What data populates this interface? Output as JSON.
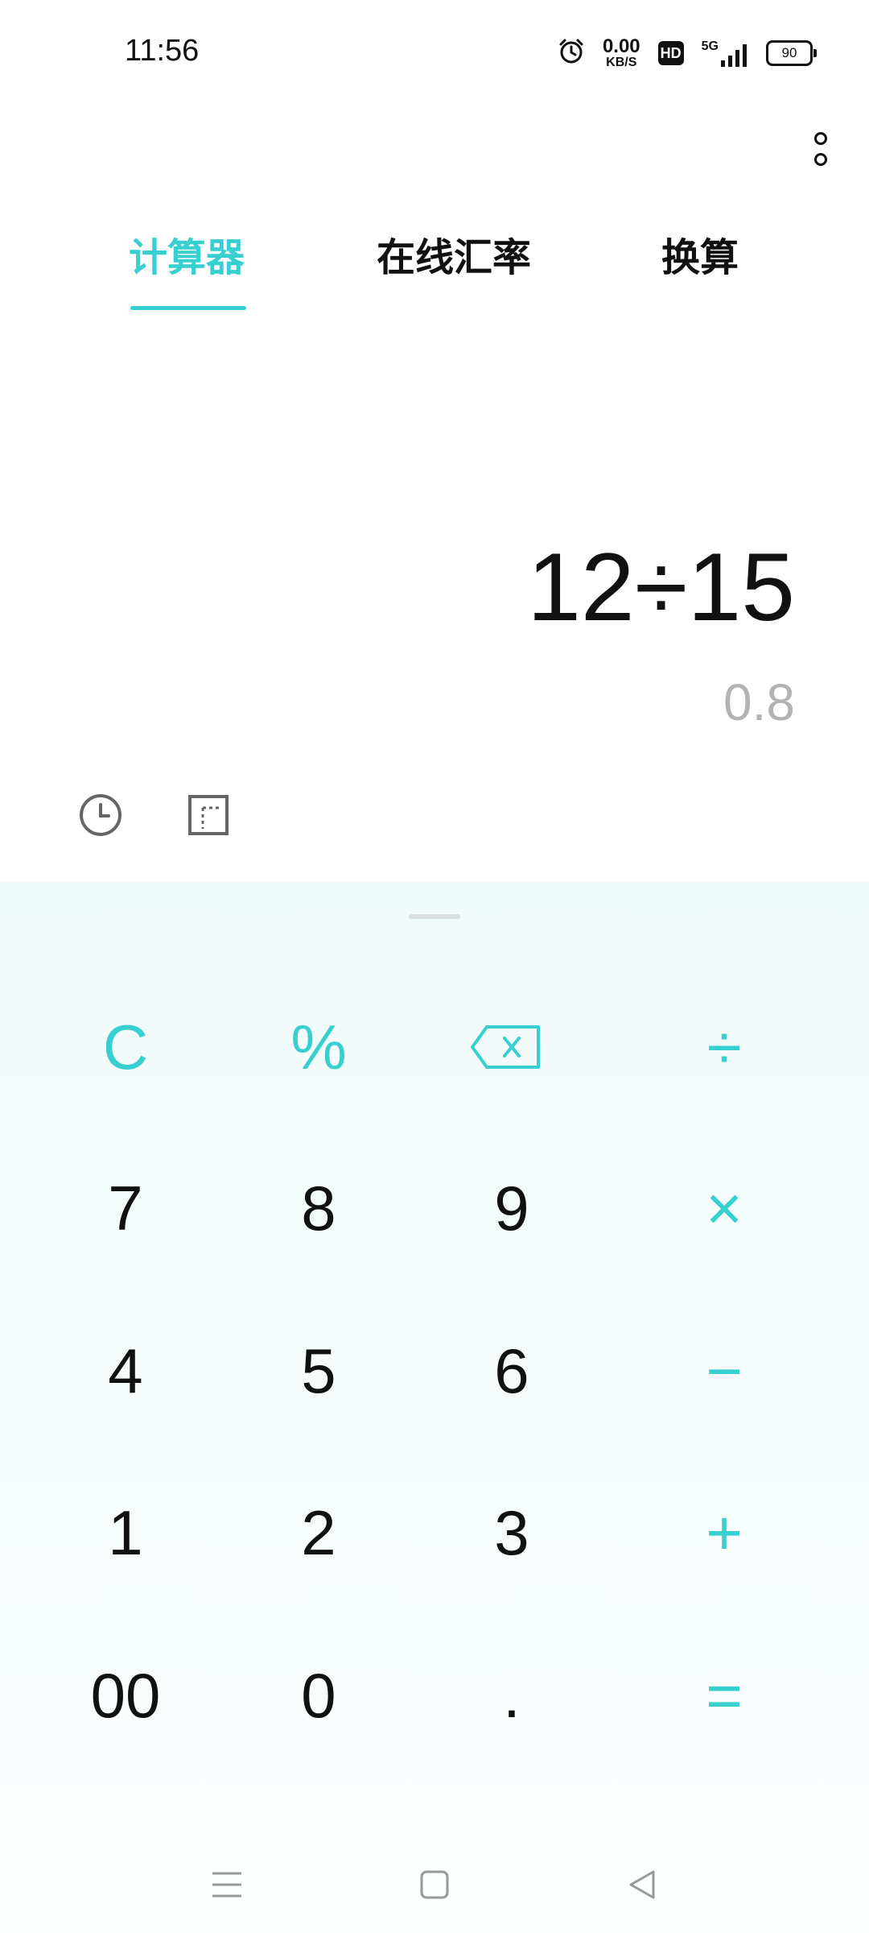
{
  "status_bar": {
    "time": "11:56",
    "net_speed_value": "0.00",
    "net_speed_unit": "KB/S",
    "hd_label": "HD",
    "network_label": "5G",
    "battery_level": "90",
    "icons": [
      "alarm-clock-icon",
      "hd-icon",
      "signal-5g-icon",
      "battery-icon"
    ]
  },
  "menu": {
    "icon": "more-vertical-icon"
  },
  "tabs": [
    {
      "label": "计算器",
      "active": true
    },
    {
      "label": "在线汇率",
      "active": false
    },
    {
      "label": "换算",
      "active": false
    }
  ],
  "display": {
    "expression": "12÷15",
    "result": "0.8"
  },
  "tools": [
    "history-icon",
    "scientific-mode-icon"
  ],
  "keypad": {
    "rows": [
      [
        {
          "label": "C",
          "name": "clear"
        },
        {
          "label": "%",
          "name": "percent"
        },
        {
          "label": "",
          "name": "backspace",
          "icon": "backspace-icon"
        },
        {
          "label": "÷",
          "name": "divide"
        }
      ],
      [
        {
          "label": "7",
          "name": "digit-7"
        },
        {
          "label": "8",
          "name": "digit-8"
        },
        {
          "label": "9",
          "name": "digit-9"
        },
        {
          "label": "×",
          "name": "multiply"
        }
      ],
      [
        {
          "label": "4",
          "name": "digit-4"
        },
        {
          "label": "5",
          "name": "digit-5"
        },
        {
          "label": "6",
          "name": "digit-6"
        },
        {
          "label": "−",
          "name": "subtract"
        }
      ],
      [
        {
          "label": "1",
          "name": "digit-1"
        },
        {
          "label": "2",
          "name": "digit-2"
        },
        {
          "label": "3",
          "name": "digit-3"
        },
        {
          "label": "+",
          "name": "add"
        }
      ],
      [
        {
          "label": "00",
          "name": "double-zero"
        },
        {
          "label": "0",
          "name": "digit-0"
        },
        {
          "label": ".",
          "name": "decimal-point"
        },
        {
          "label": "=",
          "name": "equals"
        }
      ]
    ]
  },
  "nav_bar": [
    "menu-lines-icon",
    "home-square-icon",
    "back-triangle-icon"
  ],
  "colors": {
    "accent": "#37cfcf",
    "result_text": "#b3b3b3",
    "keypad_background": "#f1fafa"
  }
}
